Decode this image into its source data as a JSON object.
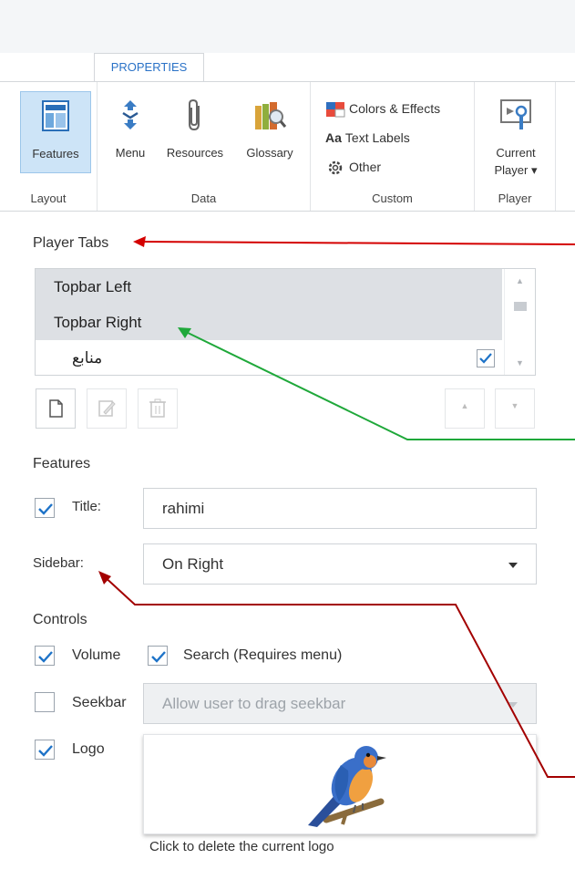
{
  "ribbon": {
    "tab_label": "PROPERTIES",
    "buttons": {
      "features": "Features",
      "menu": "Menu",
      "resources": "Resources",
      "glossary": "Glossary",
      "current_player_line1": "Current",
      "current_player_line2": "Player ▾"
    },
    "small_commands": {
      "colors_effects": "Colors & Effects",
      "text_labels": "Text Labels",
      "text_labels_prefix": "Aa",
      "other": "Other"
    },
    "groups": {
      "layout": "Layout",
      "data": "Data",
      "custom": "Custom",
      "player": "Player"
    }
  },
  "player_tabs": {
    "title": "Player Tabs",
    "items": [
      {
        "label": "Topbar Left",
        "selected": true
      },
      {
        "label": "Topbar Right",
        "selected": true
      },
      {
        "label": "منابع",
        "selected": false,
        "checked": true
      }
    ]
  },
  "features": {
    "title": "Features",
    "title_field": {
      "label": "Title:",
      "checked": true,
      "value": "rahimi"
    },
    "sidebar": {
      "label": "Sidebar:",
      "value": "On Right"
    }
  },
  "controls": {
    "title": "Controls",
    "volume": {
      "label": "Volume",
      "checked": true
    },
    "search": {
      "label": "Search (Requires menu)",
      "checked": true
    },
    "seekbar": {
      "label": "Seekbar",
      "checked": false,
      "option": "Allow user to drag seekbar"
    },
    "logo": {
      "label": "Logo",
      "checked": true,
      "hint": "Click to delete the current logo"
    }
  },
  "colors": {
    "accent": "#2a72c7",
    "check": "#1e73c8",
    "arrow_red": "#d40000",
    "arrow_green": "#1fa83a"
  }
}
